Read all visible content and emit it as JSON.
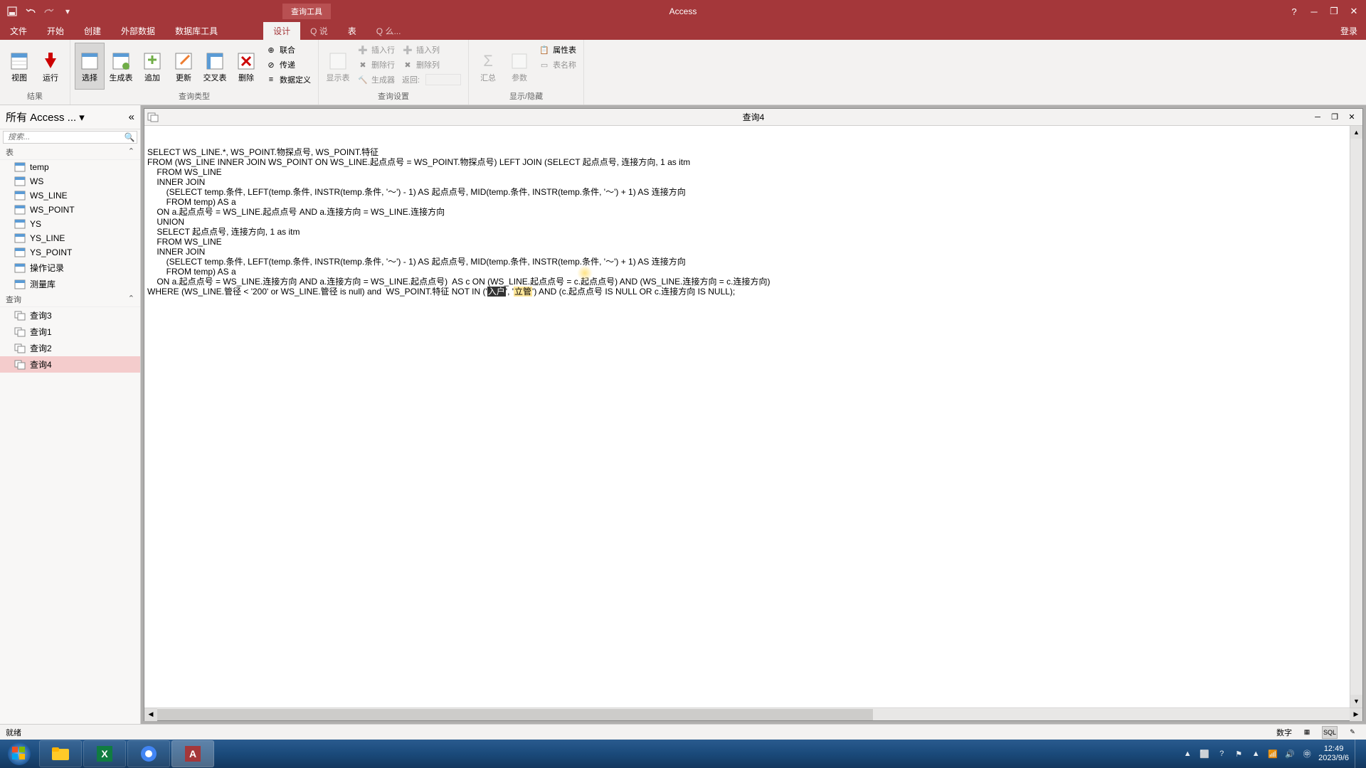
{
  "app_title": "Access",
  "context_tool": "查询工具",
  "login": "登录",
  "tabs": [
    "文件",
    "开始",
    "创建",
    "外部数据",
    "数据库工具",
    "设计",
    "Q 说",
    "表",
    "Q 么..."
  ],
  "active_tab_index": 5,
  "ribbon_groups": {
    "results": {
      "label": "结果",
      "view": "视图",
      "run": "运行"
    },
    "query_type": {
      "label": "查询类型",
      "select": "选择",
      "make": "生成表",
      "append": "追加",
      "update": "更新",
      "crosstab": "交叉表",
      "delete": "删除",
      "union": "联合",
      "passthrough": "传递",
      "data_def": "数据定义"
    },
    "setup": {
      "label": "查询设置",
      "show_table": "显示表",
      "insert_row": "插入行",
      "delete_row": "删除行",
      "builder": "生成器",
      "insert_col": "插入列",
      "delete_col": "删除列",
      "return": "返回:"
    },
    "showhide": {
      "label": "显示/隐藏",
      "totals": "汇总",
      "params": "参数",
      "sheet": "属性表",
      "table_names": "表名称"
    }
  },
  "nav": {
    "header": "所有 Access ...",
    "search_placeholder": "搜索...",
    "section_tables": "表",
    "section_queries": "查询",
    "tables": [
      "temp",
      "WS",
      "WS_LINE",
      "WS_POINT",
      "YS",
      "YS_LINE",
      "YS_POINT",
      "操作记录",
      "测量库"
    ],
    "queries": [
      "查询3",
      "查询1",
      "查询2",
      "查询4"
    ],
    "selected_query_index": 3
  },
  "doc": {
    "title": "查询4",
    "sql_lines": [
      "SELECT WS_LINE.*, WS_POINT.物探点号, WS_POINT.特征",
      "FROM (WS_LINE INNER JOIN WS_POINT ON WS_LINE.起点点号 = WS_POINT.物探点号) LEFT JOIN (SELECT 起点点号, 连接方向, 1 as itm",
      "    FROM WS_LINE",
      "    INNER JOIN",
      "        (SELECT temp.条件, LEFT(temp.条件, INSTR(temp.条件, '～') - 1) AS 起点点号, MID(temp.条件, INSTR(temp.条件, '～') + 1) AS 连接方向",
      "        FROM temp) AS a",
      "    ON a.起点点号 = WS_LINE.起点点号 AND a.连接方向 = WS_LINE.连接方向",
      "    UNION",
      "    SELECT 起点点号, 连接方向, 1 as itm",
      "    FROM WS_LINE",
      "    INNER JOIN",
      "        (SELECT temp.条件, LEFT(temp.条件, INSTR(temp.条件, '～') - 1) AS 起点点号, MID(temp.条件, INSTR(temp.条件, '～') + 1) AS 连接方向",
      "        FROM temp) AS a",
      "    ON a.起点点号 = WS_LINE.连接方向 AND a.连接方向 = WS_LINE.起点点号)  AS c ON (WS_LINE.起点点号 = c.起点点号) AND (WS_LINE.连接方向 = c.连接方向)",
      "WHERE (WS_LINE.管径 < '200' or WS_LINE.管径 is null) and  WS_POINT.特征 NOT IN ('##HL1##', '##HL2##') AND (c.起点点号 IS NULL OR c.连接方向 IS NULL);"
    ],
    "hl1_text": "入户",
    "hl2_text": "立管"
  },
  "status": {
    "ready": "就绪",
    "numlock": "数字"
  },
  "taskbar": {
    "time": "12:49",
    "date": "2023/9/6"
  }
}
